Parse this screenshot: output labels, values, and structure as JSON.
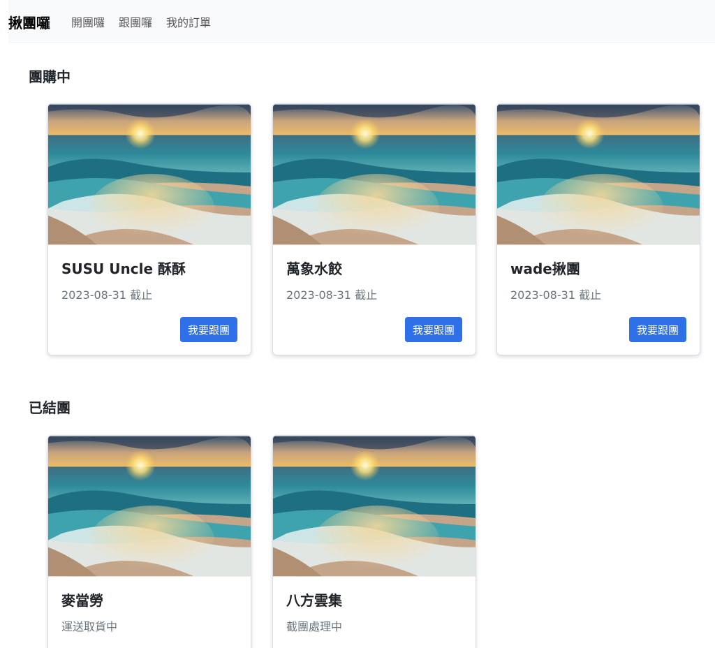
{
  "nav": {
    "brand": "揪團囉",
    "links": [
      "開團囉",
      "跟團囉",
      "我的訂單"
    ]
  },
  "sections": {
    "active_title": "團購中",
    "closed_title": "已結團"
  },
  "active_groups": [
    {
      "title": "SUSU Uncle 酥酥",
      "subtitle": "2023-08-31 截止",
      "button": "我要跟團"
    },
    {
      "title": "萬象水餃",
      "subtitle": "2023-08-31 截止",
      "button": "我要跟團"
    },
    {
      "title": "wade揪團",
      "subtitle": "2023-08-31 截止",
      "button": "我要跟團"
    }
  ],
  "closed_groups": [
    {
      "title": "麥當勞",
      "subtitle": "運送取貨中"
    },
    {
      "title": "八方雲集",
      "subtitle": "截團處理中"
    }
  ],
  "colors": {
    "primary_button": "#2f6fe8",
    "navbar_bg": "#f8f9fa"
  }
}
